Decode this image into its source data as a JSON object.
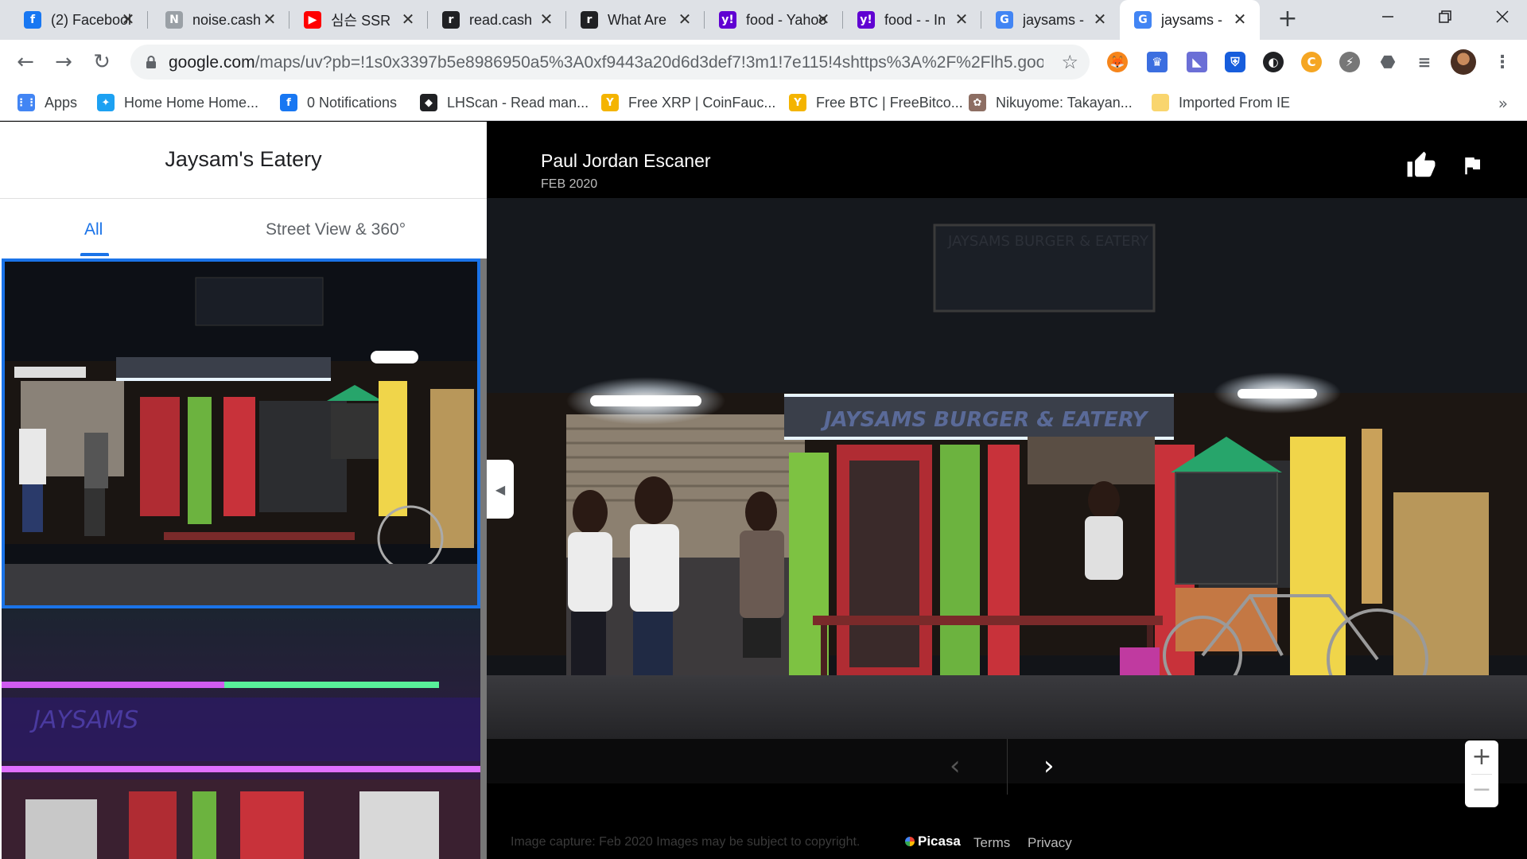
{
  "browser": {
    "tabs": [
      {
        "title": "(2) Facebook",
        "icon": "facebook-icon",
        "color": "#1877f2",
        "glyph": "f"
      },
      {
        "title": "noise.cash",
        "icon": "noise-cash-icon",
        "color": "#9aa0a6",
        "glyph": "N"
      },
      {
        "title": "심슨 SSR",
        "icon": "youtube-icon",
        "color": "#ff0000",
        "glyph": "▶"
      },
      {
        "title": "read.cash",
        "icon": "read-cash-icon",
        "color": "#202124",
        "glyph": "r"
      },
      {
        "title": "What Are",
        "icon": "read-cash-icon",
        "color": "#202124",
        "glyph": "r"
      },
      {
        "title": "food - Yahoo",
        "icon": "yahoo-icon",
        "color": "#6001d2",
        "glyph": "y!"
      },
      {
        "title": "food - - In",
        "icon": "yahoo-icon",
        "color": "#6001d2",
        "glyph": "y!"
      },
      {
        "title": "jaysams -",
        "icon": "google-icon",
        "color": "#4285f4",
        "glyph": "G"
      },
      {
        "title": "jaysams -",
        "icon": "google-icon",
        "color": "#4285f4",
        "glyph": "G"
      }
    ],
    "active_tab": 8,
    "new_tab_label": "+",
    "url_host": "google.com",
    "url_path": "/maps/uv?pb=!1s0x3397b5e8986950a5%3A0xf9443a20d6d3def7!3m1!7e115!4shttps%3A%2F%2Flh5.goo...",
    "bookmarks": [
      {
        "label": "Apps",
        "icon": "apps-grid-icon",
        "color": "#4285f4",
        "glyph": "⋮⋮"
      },
      {
        "label": "Home Home Home...",
        "icon": "twitter-icon",
        "color": "#1da1f2",
        "glyph": "✦"
      },
      {
        "label": "0 Notifications",
        "icon": "facebook-icon",
        "color": "#1877f2",
        "glyph": "f"
      },
      {
        "label": "LHScan - Read man...",
        "icon": "shield-icon",
        "color": "#202124",
        "glyph": "◆"
      },
      {
        "label": "Free XRP | CoinFauc...",
        "icon": "faucet-icon",
        "color": "#f4b400",
        "glyph": "Y"
      },
      {
        "label": "Free BTC | FreeBitco...",
        "icon": "faucet-icon",
        "color": "#f4b400",
        "glyph": "Y"
      },
      {
        "label": "Nikuyome: Takayan...",
        "icon": "manga-icon",
        "color": "#8d6e63",
        "glyph": "✿"
      },
      {
        "label": "Imported From IE",
        "icon": "folder-icon",
        "color": "#f9d56e",
        "glyph": ""
      }
    ],
    "bookmarks_more": "»"
  },
  "panel": {
    "title": "Jaysam's Eatery",
    "tabs": [
      "All",
      "Street View & 360°"
    ],
    "active_tab": "All"
  },
  "photo": {
    "author": "Paul Jordan Escaner",
    "date": "FEB 2020",
    "sign_text": "JAYSAMS BURGER & EATERY",
    "capture_note": "Image capture: Feb 2020    Images may be subject to copyright.",
    "provider": "Picasa",
    "terms": "Terms",
    "privacy": "Privacy",
    "zoom_in": "+",
    "zoom_out": "−"
  },
  "colors": {
    "accent": "#1a73e8",
    "neon_white": "#e8f4ff",
    "stall_green": "#7dc242",
    "stall_red": "#c8323a"
  }
}
